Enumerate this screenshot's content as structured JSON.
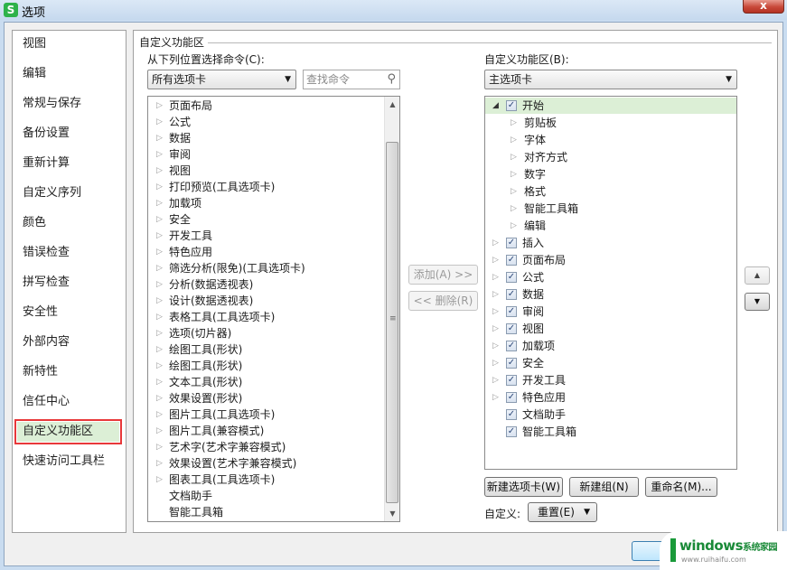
{
  "window": {
    "title": "选项",
    "app_icon": "wps-spreadsheet-icon",
    "close_label": "x"
  },
  "nav": {
    "items": [
      {
        "label": "视图",
        "active": false
      },
      {
        "label": "编辑",
        "active": false
      },
      {
        "label": "常规与保存",
        "active": false
      },
      {
        "label": "备份设置",
        "active": false
      },
      {
        "label": "重新计算",
        "active": false
      },
      {
        "label": "自定义序列",
        "active": false
      },
      {
        "label": "颜色",
        "active": false
      },
      {
        "label": "错误检查",
        "active": false
      },
      {
        "label": "拼写检查",
        "active": false
      },
      {
        "label": "安全性",
        "active": false
      },
      {
        "label": "外部内容",
        "active": false
      },
      {
        "label": "新特性",
        "active": false
      },
      {
        "label": "信任中心",
        "active": false
      },
      {
        "label": "自定义功能区",
        "active": true
      },
      {
        "label": "快速访问工具栏",
        "active": false
      }
    ]
  },
  "panel": {
    "group_title": "自定义功能区",
    "left": {
      "label": "从下列位置选择命令(C):",
      "select_value": "所有选项卡",
      "search_placeholder": "查找命令",
      "items": [
        {
          "label": "页面布局",
          "expandable": true
        },
        {
          "label": "公式",
          "expandable": true
        },
        {
          "label": "数据",
          "expandable": true
        },
        {
          "label": "审阅",
          "expandable": true
        },
        {
          "label": "视图",
          "expandable": true
        },
        {
          "label": "打印预览(工具选项卡)",
          "expandable": true
        },
        {
          "label": "加载项",
          "expandable": true
        },
        {
          "label": "安全",
          "expandable": true
        },
        {
          "label": "开发工具",
          "expandable": true
        },
        {
          "label": "特色应用",
          "expandable": true
        },
        {
          "label": "筛选分析(限免)(工具选项卡)",
          "expandable": true
        },
        {
          "label": "分析(数据透视表)",
          "expandable": true
        },
        {
          "label": "设计(数据透视表)",
          "expandable": true
        },
        {
          "label": "表格工具(工具选项卡)",
          "expandable": true
        },
        {
          "label": "选项(切片器)",
          "expandable": true
        },
        {
          "label": "绘图工具(形状)",
          "expandable": true
        },
        {
          "label": "绘图工具(形状)",
          "expandable": true
        },
        {
          "label": "文本工具(形状)",
          "expandable": true
        },
        {
          "label": "效果设置(形状)",
          "expandable": true
        },
        {
          "label": "图片工具(工具选项卡)",
          "expandable": true
        },
        {
          "label": "图片工具(兼容模式)",
          "expandable": true
        },
        {
          "label": "艺术字(艺术字兼容模式)",
          "expandable": true
        },
        {
          "label": "效果设置(艺术字兼容模式)",
          "expandable": true
        },
        {
          "label": "图表工具(工具选项卡)",
          "expandable": true
        },
        {
          "label": "文档助手",
          "expandable": false
        },
        {
          "label": "智能工具箱",
          "expandable": false
        }
      ]
    },
    "middle": {
      "add_label": "添加(A) >>",
      "remove_label": "<< 删除(R)"
    },
    "right": {
      "label": "自定义功能区(B):",
      "select_value": "主选项卡",
      "items": [
        {
          "label": "开始",
          "level": 0,
          "expanded": true,
          "checked": true,
          "selected": true,
          "expandable": true
        },
        {
          "label": "剪贴板",
          "level": 1,
          "expandable": true
        },
        {
          "label": "字体",
          "level": 1,
          "expandable": true
        },
        {
          "label": "对齐方式",
          "level": 1,
          "expandable": true
        },
        {
          "label": "数字",
          "level": 1,
          "expandable": true
        },
        {
          "label": "格式",
          "level": 1,
          "expandable": true
        },
        {
          "label": "智能工具箱",
          "level": 1,
          "expandable": true
        },
        {
          "label": "编辑",
          "level": 1,
          "expandable": true
        },
        {
          "label": "插入",
          "level": 0,
          "checked": true,
          "expandable": true
        },
        {
          "label": "页面布局",
          "level": 0,
          "checked": true,
          "expandable": true
        },
        {
          "label": "公式",
          "level": 0,
          "checked": true,
          "expandable": true
        },
        {
          "label": "数据",
          "level": 0,
          "checked": true,
          "expandable": true
        },
        {
          "label": "审阅",
          "level": 0,
          "checked": true,
          "expandable": true
        },
        {
          "label": "视图",
          "level": 0,
          "checked": true,
          "expandable": true
        },
        {
          "label": "加载项",
          "level": 0,
          "checked": true,
          "expandable": true
        },
        {
          "label": "安全",
          "level": 0,
          "checked": true,
          "expandable": true
        },
        {
          "label": "开发工具",
          "level": 0,
          "checked": true,
          "expandable": true
        },
        {
          "label": "特色应用",
          "level": 0,
          "checked": true,
          "expandable": true
        },
        {
          "label": "文档助手",
          "level": 0,
          "checked": true,
          "expandable": false
        },
        {
          "label": "智能工具箱",
          "level": 0,
          "checked": true,
          "expandable": false
        }
      ],
      "new_tab_label": "新建选项卡(W)",
      "new_group_label": "新建组(N)",
      "rename_label": "重命名(M)...",
      "customize_label": "自定义:",
      "reset_label": "重置(E)"
    },
    "move_up_icon": "triangle-up-icon",
    "move_down_icon": "triangle-down-icon"
  },
  "watermark": {
    "brand": "windows",
    "brand_suffix": "系统家园",
    "url": "www.ruihaifu.com"
  }
}
